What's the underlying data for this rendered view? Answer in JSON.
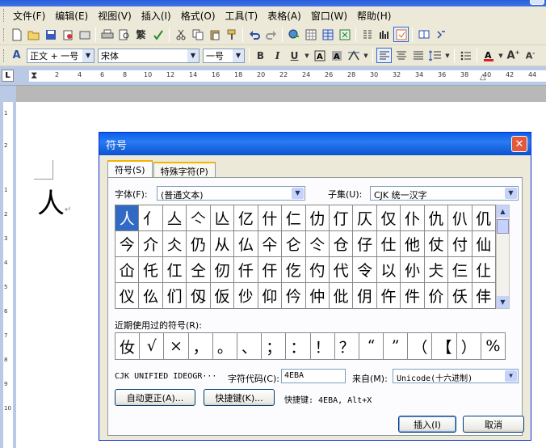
{
  "menubar": {
    "items": [
      "文件(F)",
      "编辑(E)",
      "视图(V)",
      "插入(I)",
      "格式(O)",
      "工具(T)",
      "表格(A)",
      "窗口(W)",
      "帮助(H)"
    ]
  },
  "toolbar1": {
    "icons": [
      "new-doc-icon",
      "open-icon",
      "save-icon",
      "permission-icon",
      "email-icon",
      "print-icon",
      "print-preview-icon",
      "fan-jian-convert-icon",
      "spelling-icon",
      "cut-icon",
      "copy-icon",
      "paste-icon",
      "format-painter-icon",
      "undo-icon",
      "redo-icon",
      "hyperlink-icon",
      "tables-borders-icon",
      "insert-table-icon",
      "insert-excel-icon",
      "columns-icon",
      "drawing-icon",
      "document-map-icon",
      "reading-icon",
      "help-icon"
    ],
    "fan_label": "繁"
  },
  "toolbar2": {
    "style_value": "正文 + 一号",
    "font_value": "宋体",
    "size_value": "一号",
    "bold": "B",
    "italic": "I",
    "underline": "U"
  },
  "ruler": {
    "numbers": [
      "2",
      "4",
      "6",
      "8",
      "10",
      "12",
      "14",
      "16",
      "18",
      "20",
      "22",
      "24",
      "26",
      "28",
      "30",
      "32",
      "34",
      "36",
      "38",
      "40",
      "42",
      "44"
    ],
    "tab_marker": "L"
  },
  "vruler": {
    "numbers": [
      "1",
      "2",
      "1",
      "2",
      "3",
      "4",
      "5",
      "6",
      "7",
      "8",
      "9",
      "10"
    ]
  },
  "document": {
    "char": "人",
    "para_mark": "↵"
  },
  "dialog": {
    "title": "符号",
    "tabs": [
      "符号(S)",
      "特殊字符(P)"
    ],
    "font_label": "字体(F):",
    "font_value": "(普通文本)",
    "subset_label": "子集(U):",
    "subset_value": "CJK 统一汉字",
    "grid": [
      [
        "人",
        "亻",
        "亼",
        "亽",
        "亾",
        "亿",
        "什",
        "仁",
        "仂",
        "仃",
        "仄",
        "仅",
        "仆",
        "仇",
        "仈",
        "仉"
      ],
      [
        "今",
        "介",
        "仌",
        "仍",
        "从",
        "仏",
        "仐",
        "仑",
        "仒",
        "仓",
        "仔",
        "仕",
        "他",
        "仗",
        "付",
        "仙"
      ],
      [
        "仚",
        "仛",
        "仜",
        "仝",
        "仞",
        "仟",
        "仠",
        "仡",
        "仢",
        "代",
        "令",
        "以",
        "仦",
        "仧",
        "仨",
        "仩"
      ],
      [
        "仪",
        "仫",
        "们",
        "仭",
        "仮",
        "仯",
        "仰",
        "仱",
        "仲",
        "仳",
        "仴",
        "仵",
        "件",
        "价",
        "仸",
        "仹"
      ]
    ],
    "recent_label": "近期使用过的符号(R):",
    "recent": [
      "㚢",
      "√",
      "×",
      "，",
      "。",
      "、",
      "；",
      "：",
      "！",
      "？",
      "“",
      "”",
      "（",
      "【",
      "）",
      "%"
    ],
    "char_name": "CJK UNIFIED IDEOGR···",
    "code_label": "字符代码(C):",
    "code_value": "4EBA",
    "from_label": "来自(M):",
    "from_value": "Unicode(十六进制)",
    "autocorrect_label": "自动更正(A)...",
    "shortcut_label": "快捷键(K)...",
    "shortcut_text": "快捷键: 4EBA, Alt+X",
    "insert_label": "插入(I)",
    "cancel_label": "取消",
    "close_glyph": "✕"
  }
}
